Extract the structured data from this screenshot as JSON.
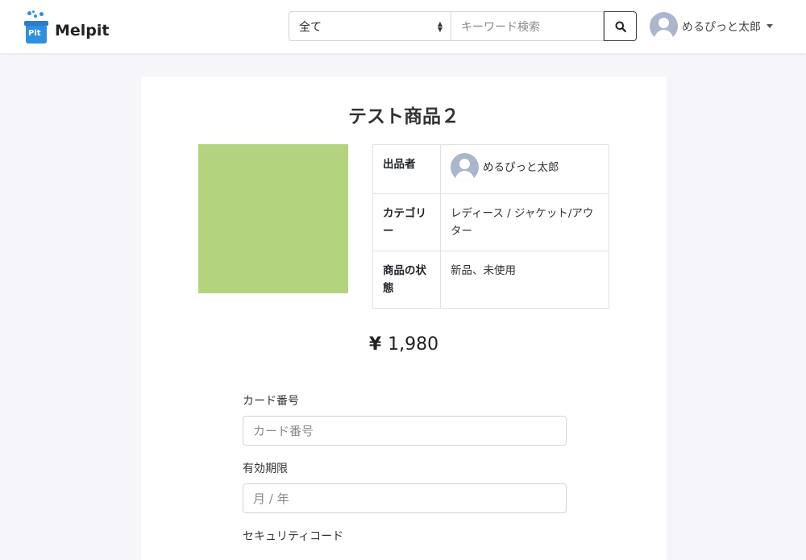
{
  "navbar": {
    "brand_name": "Melpit",
    "logo_text": "Pit",
    "category_select_value": "全て",
    "search_placeholder": "キーワード検索",
    "user_name": "めるぴっと太郎"
  },
  "product": {
    "title": "テスト商品２",
    "image_color": "#b3d37f",
    "table": {
      "seller_label": "出品者",
      "seller_name": "めるぴっと太郎",
      "category_label": "カテゴリー",
      "category_value": "レディース / ジャケット/アウター",
      "condition_label": "商品の状態",
      "condition_value": "新品、未使用"
    },
    "price_symbol": "¥",
    "price_value": "1,980"
  },
  "payment_form": {
    "card_number_label": "カード番号",
    "card_number_placeholder": "カード番号",
    "expiry_label": "有効期限",
    "expiry_placeholder": "月 / 年",
    "cvc_label": "セキュリティコード"
  },
  "colors": {
    "page_background": "#f5f5fa",
    "accent_logo": "#2f8ee0",
    "avatar_grey": "#a9b6cc"
  },
  "icons": [
    "search-icon",
    "user-avatar-icon",
    "caret-down-icon",
    "select-arrows-icon"
  ]
}
